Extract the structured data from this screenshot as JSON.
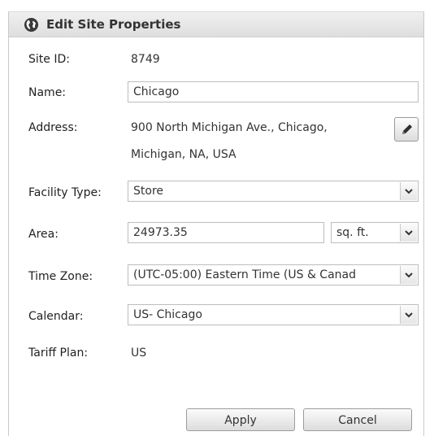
{
  "dialog": {
    "title": "Edit Site Properties",
    "icon": "globe-icon"
  },
  "fields": {
    "site_id": {
      "label": "Site ID:",
      "value": "8749"
    },
    "name": {
      "label": "Name:",
      "value": "Chicago"
    },
    "address": {
      "label": "Address:",
      "line1": "900 North Michigan Ave., Chicago,",
      "line2": "Michigan, NA, USA",
      "edit_icon": "pencil-icon"
    },
    "facility_type": {
      "label": "Facility Type:",
      "selected": "Store"
    },
    "area": {
      "label": "Area:",
      "value": "24973.35",
      "unit_selected": "sq. ft."
    },
    "time_zone": {
      "label": "Time Zone:",
      "selected": "(UTC-05:00) Eastern Time (US & Canad"
    },
    "calendar": {
      "label": "Calendar:",
      "selected": "US- Chicago"
    },
    "tariff_plan": {
      "label": "Tariff Plan:",
      "value": "US"
    }
  },
  "buttons": {
    "apply": "Apply",
    "cancel": "Cancel"
  },
  "colors": {
    "header_bg": "#e6e6e6",
    "border": "#bdbdbd"
  }
}
